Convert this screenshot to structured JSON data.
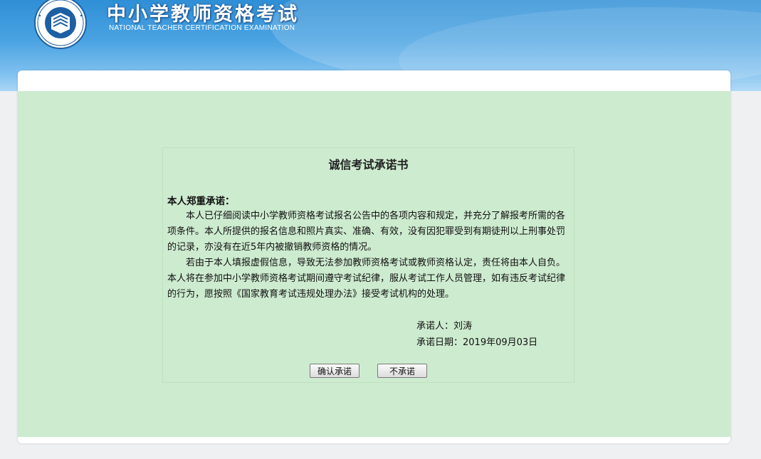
{
  "header": {
    "title": "中小学教师资格考试",
    "subtitle": "NATIONAL TEACHER CERTIFICATION EXAMINATION",
    "logo_icon": "book-seal-icon"
  },
  "document": {
    "title": "诚信考试承诺书",
    "heading": "本人郑重承诺：",
    "paragraphs": [
      "本人已仔细阅读中小学教师资格考试报名公告中的各项内容和规定，并充分了解报考所需的各项条件。本人所提供的报名信息和照片真实、准确、有效，没有因犯罪受到有期徒刑以上刑事处罚的记录，亦没有在近5年内被撤销教师资格的情况。",
      "若由于本人填报虚假信息，导致无法参加教师资格考试或教师资格认定，责任将由本人自负。本人将在参加中小学教师资格考试期间遵守考试纪律，服从考试工作人员管理，如有违反考试纪律的行为，愿按照《国家教育考试违规处理办法》接受考试机构的处理。"
    ],
    "signer": "承诺人：刘涛",
    "date": "承诺日期：2019年09月03日"
  },
  "actions": {
    "confirm_label": "确认承诺",
    "decline_label": "不承诺"
  },
  "colors": {
    "header_blue": "#3a98dc",
    "body_green": "#cdebcf"
  }
}
